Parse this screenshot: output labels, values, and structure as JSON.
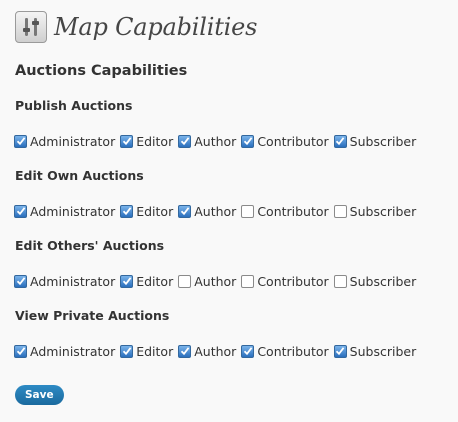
{
  "header": {
    "title": "Map Capabilities",
    "icon": "settings-sliders-icon"
  },
  "section": {
    "title": "Auctions Capabilities"
  },
  "groups": [
    {
      "title": "Publish Auctions",
      "roles": [
        {
          "label": "Administrator",
          "checked": true
        },
        {
          "label": "Editor",
          "checked": true
        },
        {
          "label": "Author",
          "checked": true
        },
        {
          "label": "Contributor",
          "checked": true
        },
        {
          "label": "Subscriber",
          "checked": true
        }
      ]
    },
    {
      "title": "Edit Own Auctions",
      "roles": [
        {
          "label": "Administrator",
          "checked": true
        },
        {
          "label": "Editor",
          "checked": true
        },
        {
          "label": "Author",
          "checked": true
        },
        {
          "label": "Contributor",
          "checked": false
        },
        {
          "label": "Subscriber",
          "checked": false
        }
      ]
    },
    {
      "title": "Edit Others' Auctions",
      "roles": [
        {
          "label": "Administrator",
          "checked": true
        },
        {
          "label": "Editor",
          "checked": true
        },
        {
          "label": "Author",
          "checked": false
        },
        {
          "label": "Contributor",
          "checked": false
        },
        {
          "label": "Subscriber",
          "checked": false
        }
      ]
    },
    {
      "title": "View Private Auctions",
      "roles": [
        {
          "label": "Administrator",
          "checked": true
        },
        {
          "label": "Editor",
          "checked": true
        },
        {
          "label": "Author",
          "checked": true
        },
        {
          "label": "Contributor",
          "checked": true
        },
        {
          "label": "Subscriber",
          "checked": true
        }
      ]
    }
  ],
  "save_label": "Save",
  "colors": {
    "background": "#f9f9f9",
    "checkbox_checked": "#2a6fbd",
    "save_button": "#21759b"
  }
}
